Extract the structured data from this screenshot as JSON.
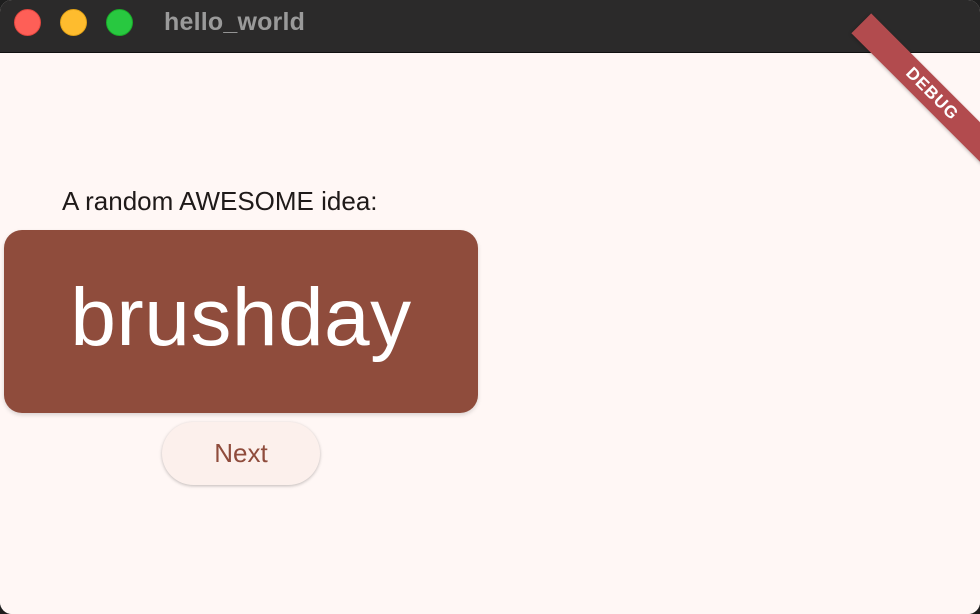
{
  "window": {
    "title": "hello_world"
  },
  "banner": {
    "label": "DEBUG"
  },
  "main": {
    "caption": "A random AWESOME idea:",
    "idea": "brushday",
    "next_label": "Next"
  },
  "colors": {
    "card_background": "#8f4c3c",
    "page_background": "#fff7f5",
    "button_background": "#fcf0ec",
    "debug_ribbon": "#b24b4e"
  }
}
